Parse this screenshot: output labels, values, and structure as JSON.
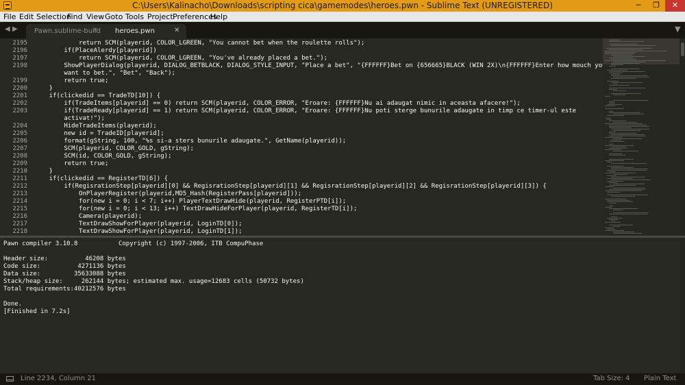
{
  "window": {
    "title": "C:\\Users\\Kalinacho\\Downloads\\scripting cica\\gamemodes\\heroes.pwn - Sublime Text (UNREGISTERED)",
    "buttons": {
      "minimize": "─",
      "maximize": "❐",
      "close": "✕"
    }
  },
  "menu": [
    "File",
    "Edit",
    "Selection",
    "Find",
    "View",
    "Goto",
    "Tools",
    "Project",
    "Preferences",
    "Help"
  ],
  "tabs": {
    "nav_left": "◀",
    "nav_right": "▶",
    "overflow": "▼",
    "items": [
      {
        "label": "Pawn.sublime-build",
        "close": "✕",
        "active": false
      },
      {
        "label": "heroes.pwn",
        "close": "✕",
        "active": true
      }
    ]
  },
  "editor": {
    "rows": [
      {
        "num": "2195",
        "text": "            return SCM(playerid, COLOR_LGREEN, \"You cannot bet when the roulette rolls\");"
      },
      {
        "num": "2196",
        "text": "        if(PlaceAlerdy[playerid])"
      },
      {
        "num": "2197",
        "text": "            return SCM(playerid, COLOR_LGREEN, \"You've already placed a bet.\");"
      },
      {
        "num": "2198",
        "text": "        ShowPlayerDialog(playerid, DIALOG_BETBLACK, DIALOG_STYLE_INPUT, \"Place a bet\", \"{FFFFFF}Bet on {656665}BLACK (WIN 2X)\\n{FFFFFF}Enter how mouch you"
      },
      {
        "num": "",
        "text": "        want to bet.\", \"Bet\", \"Back\");"
      },
      {
        "num": "2199",
        "text": "        return true;"
      },
      {
        "num": "2200",
        "text": "    }"
      },
      {
        "num": "2201",
        "text": "    if(clickedid == TradeTD[10]) {"
      },
      {
        "num": "2202",
        "text": "        if(TradeItems[playerid] == 0) return SCM(playerid, COLOR_ERROR, \"Eroare: {FFFFFF}Nu ai adaugat nimic in aceasta afacere!\");"
      },
      {
        "num": "2203",
        "text": "        if(TradeReady[playerid] == 1) return SCM(playerid, COLOR_ERROR, \"Eroare: {FFFFFF}Nu poti sterge bunurile adaugate in timp ce timer-ul este"
      },
      {
        "num": "",
        "text": "        activat!\");"
      },
      {
        "num": "2204",
        "text": "        HideTradeItems(playerid);"
      },
      {
        "num": "2205",
        "text": "        new id = TradeID[playerid];"
      },
      {
        "num": "2206",
        "text": "        format(gString, 100, \"%s si-a sters bunurile adaugate.\", GetName(playerid));"
      },
      {
        "num": "2207",
        "text": "        SCM(playerid, COLOR_GOLD, gString);"
      },
      {
        "num": "2208",
        "text": "        SCM(id, COLOR_GOLD, gString);"
      },
      {
        "num": "2209",
        "text": "        return true;"
      },
      {
        "num": "2210",
        "text": "    }"
      },
      {
        "num": "2211",
        "text": "    if(clickedid == RegisterTD[6]) {"
      },
      {
        "num": "2212",
        "text": "        if(RegisrationStep[playerid][0] && RegisrationStep[playerid][1] && RegisrationStep[playerid][2] && RegisrationStep[playerid][3]) {"
      },
      {
        "num": "2213",
        "text": "            OnPlayerRegister(playerid,MD5_Hash(RegisterPass[playerid]));"
      },
      {
        "num": "2214",
        "text": "            for(new i = 0; i < 7; i++) PlayerTextDrawHide(playerid, RegisterPTD[i]);"
      },
      {
        "num": "2215",
        "text": "            for(new i = 0; i < 13; i++) TextDrawHideForPlayer(playerid, RegisterTD[i]);"
      },
      {
        "num": "2216",
        "text": "            Camera(playerid);"
      },
      {
        "num": "2217",
        "text": "            TextDrawShowForPlayer(playerid, LoginTD[0]);"
      },
      {
        "num": "2218",
        "text": "            TextDrawShowForPlayer(playerid, LoginTD[1]);"
      }
    ]
  },
  "output": {
    "lines": [
      "Pawn compiler 3.10.8           Copyright (c) 1997-2006, ITB CompuPhase",
      "",
      "Header size:          46208 bytes",
      "Code size:          4271136 bytes",
      "Data size:         35633088 bytes",
      "Stack/heap size:     262144 bytes; estimated max. usage=12683 cells (50732 bytes)",
      "Total requirements:40212576 bytes",
      "",
      "Done.",
      "[Finished in 7.2s]"
    ]
  },
  "status": {
    "position": "Line 2234, Column 21",
    "tab_size": "Tab Size: 4",
    "syntax": "Plain Text"
  }
}
